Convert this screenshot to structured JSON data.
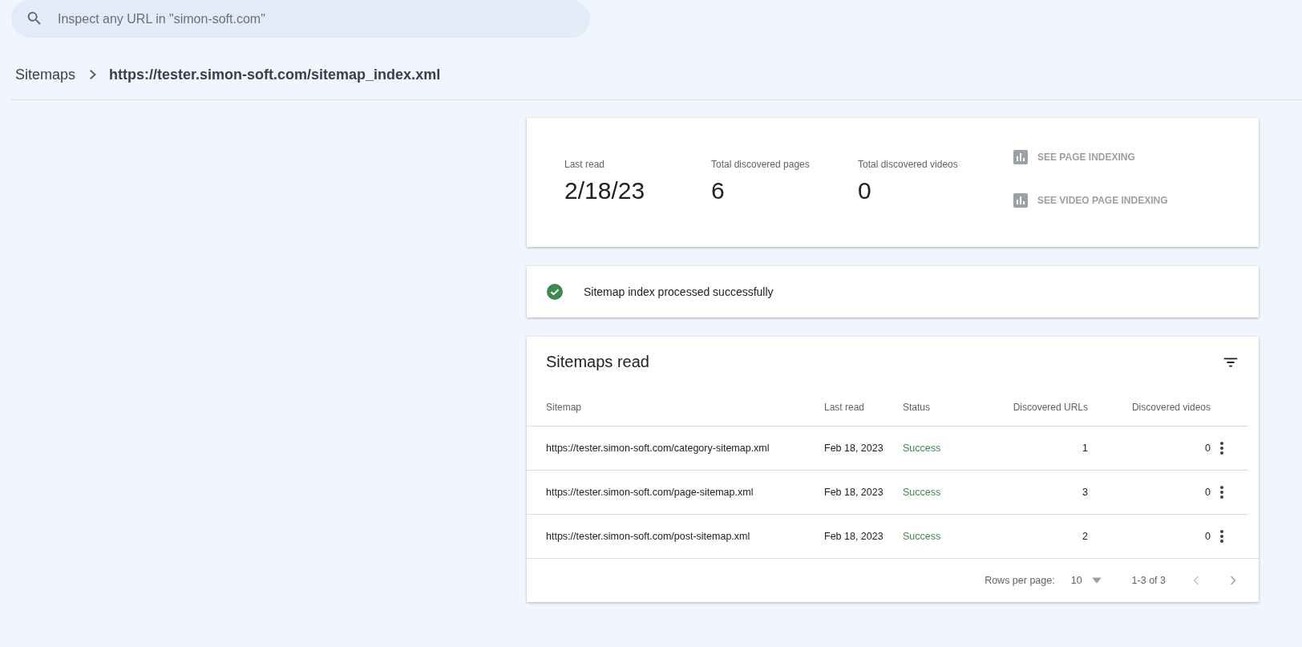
{
  "search": {
    "placeholder": "Inspect any URL in \"simon-soft.com\""
  },
  "breadcrumb": {
    "parent": "Sitemaps",
    "current": "https://tester.simon-soft.com/sitemap_index.xml"
  },
  "summary": {
    "stats": [
      {
        "label": "Last read",
        "value": "2/18/23"
      },
      {
        "label": "Total discovered pages",
        "value": "6"
      },
      {
        "label": "Total discovered videos",
        "value": "0"
      }
    ],
    "links": [
      {
        "label": "SEE PAGE INDEXING",
        "disabled": true
      },
      {
        "label": "SEE VIDEO PAGE INDEXING",
        "disabled": true
      }
    ]
  },
  "status_message": {
    "kind": "success",
    "text": "Sitemap index processed successfully"
  },
  "table": {
    "title": "Sitemaps read",
    "columns": [
      "Sitemap",
      "Last read",
      "Status",
      "Discovered URLs",
      "Discovered videos"
    ],
    "rows": [
      {
        "sitemap": "https://tester.simon-soft.com/category-sitemap.xml",
        "last_read": "Feb 18, 2023",
        "status": "Success",
        "color": "#3c8a4f",
        "urls": "1",
        "videos": "0"
      },
      {
        "sitemap": "https://tester.simon-soft.com/page-sitemap.xml",
        "last_read": "Feb 18, 2023",
        "status": "Success",
        "color": "#3c8a4f",
        "urls": "3",
        "videos": "0"
      },
      {
        "sitemap": "https://tester.simon-soft.com/post-sitemap.xml",
        "last_read": "Feb 18, 2023",
        "status": "Success",
        "color": "#3c8a4f",
        "urls": "2",
        "videos": "0"
      }
    ],
    "pagination": {
      "rows_per_page_label": "Rows per page:",
      "rows_per_page": "10",
      "range": "1-3 of 3",
      "prev_disabled": true,
      "next_disabled": false
    }
  }
}
